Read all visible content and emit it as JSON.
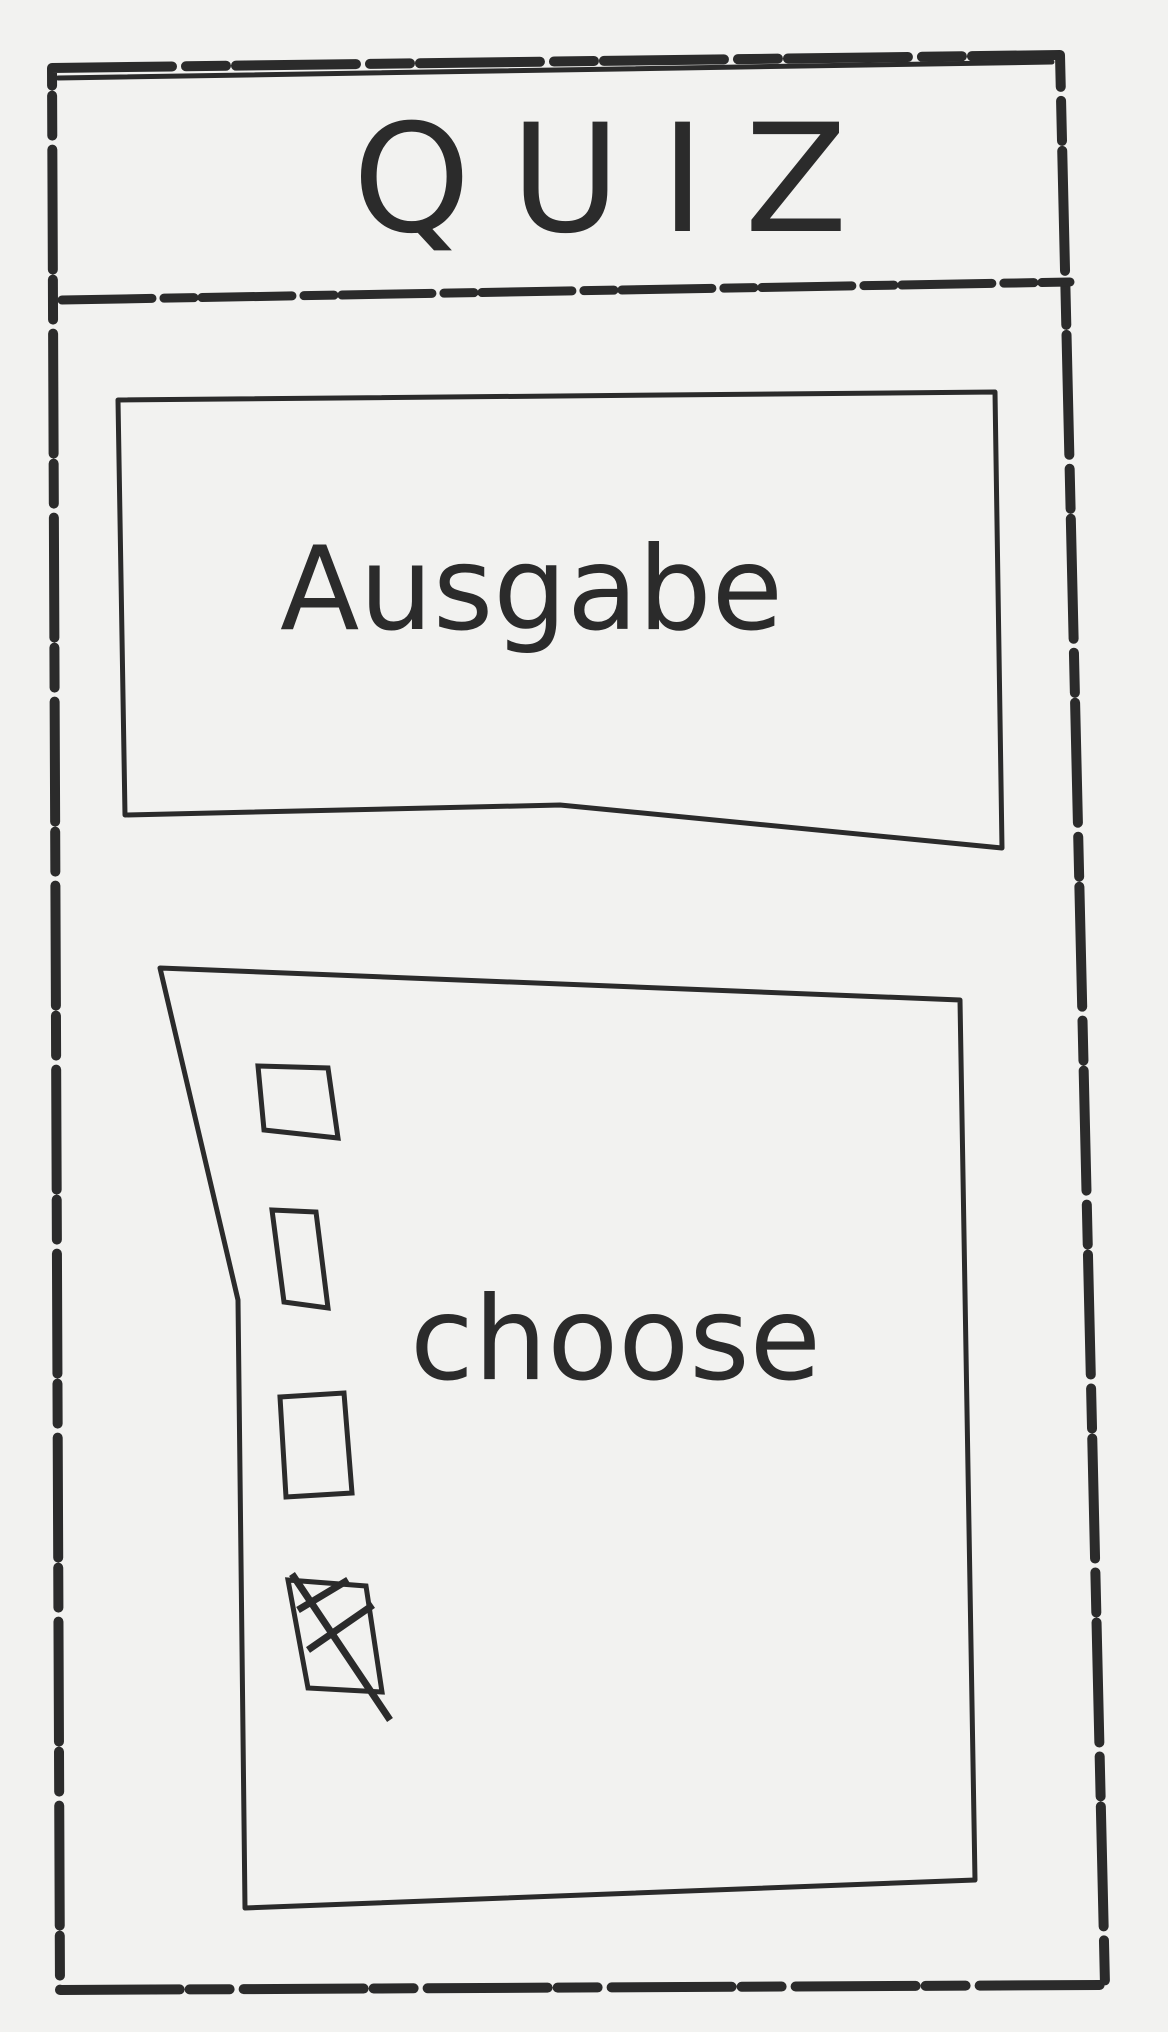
{
  "header": {
    "title": "QUIZ"
  },
  "output_box": {
    "label": "Ausgabe"
  },
  "choice_panel": {
    "label": "choose",
    "options": [
      {
        "checked": false
      },
      {
        "checked": false
      },
      {
        "checked": false
      },
      {
        "checked": true
      }
    ]
  },
  "colors": {
    "ink": "#2b2b2b",
    "paper": "#f2f2f0"
  }
}
